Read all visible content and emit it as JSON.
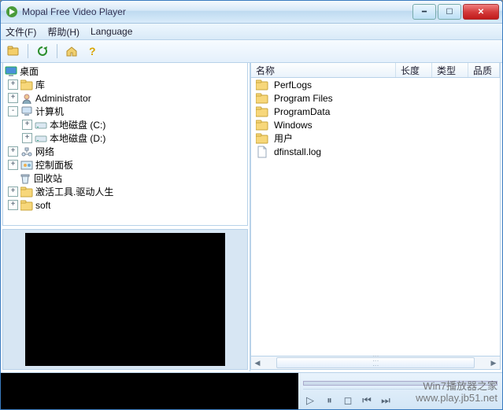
{
  "titlebar": {
    "title": "Mopal Free Video Player"
  },
  "menu": {
    "file": "文件(F)",
    "help": "帮助(H)",
    "language": "Language"
  },
  "tree": {
    "root": "桌面",
    "items": [
      {
        "exp": "+",
        "indent": 0,
        "icon": "folder",
        "label": "库"
      },
      {
        "exp": "+",
        "indent": 0,
        "icon": "user",
        "label": "Administrator"
      },
      {
        "exp": "-",
        "indent": 0,
        "icon": "pc",
        "label": "计算机"
      },
      {
        "exp": "+",
        "indent": 1,
        "icon": "drive",
        "label": "本地磁盘 (C:)"
      },
      {
        "exp": "+",
        "indent": 1,
        "icon": "drive",
        "label": "本地磁盘 (D:)"
      },
      {
        "exp": "+",
        "indent": 0,
        "icon": "net",
        "label": "网络"
      },
      {
        "exp": "+",
        "indent": 0,
        "icon": "panel",
        "label": "控制面板"
      },
      {
        "exp": "",
        "indent": 0,
        "icon": "bin",
        "label": "回收站"
      },
      {
        "exp": "+",
        "indent": 0,
        "icon": "folder",
        "label": "激活工具.驱动人生"
      },
      {
        "exp": "+",
        "indent": 0,
        "icon": "folder",
        "label": "soft"
      }
    ]
  },
  "list": {
    "columns": {
      "name": "名称",
      "length": "长度",
      "type": "类型",
      "quality": "品质"
    },
    "items": [
      {
        "icon": "folder",
        "name": "PerfLogs"
      },
      {
        "icon": "folder",
        "name": "Program Files"
      },
      {
        "icon": "folder",
        "name": "ProgramData"
      },
      {
        "icon": "folder",
        "name": "Windows"
      },
      {
        "icon": "folder",
        "name": "用户"
      },
      {
        "icon": "file",
        "name": "dfinstall.log"
      }
    ]
  },
  "watermark": {
    "line1": "Win7播放器之家",
    "line2": "www.play.jb51.net"
  }
}
